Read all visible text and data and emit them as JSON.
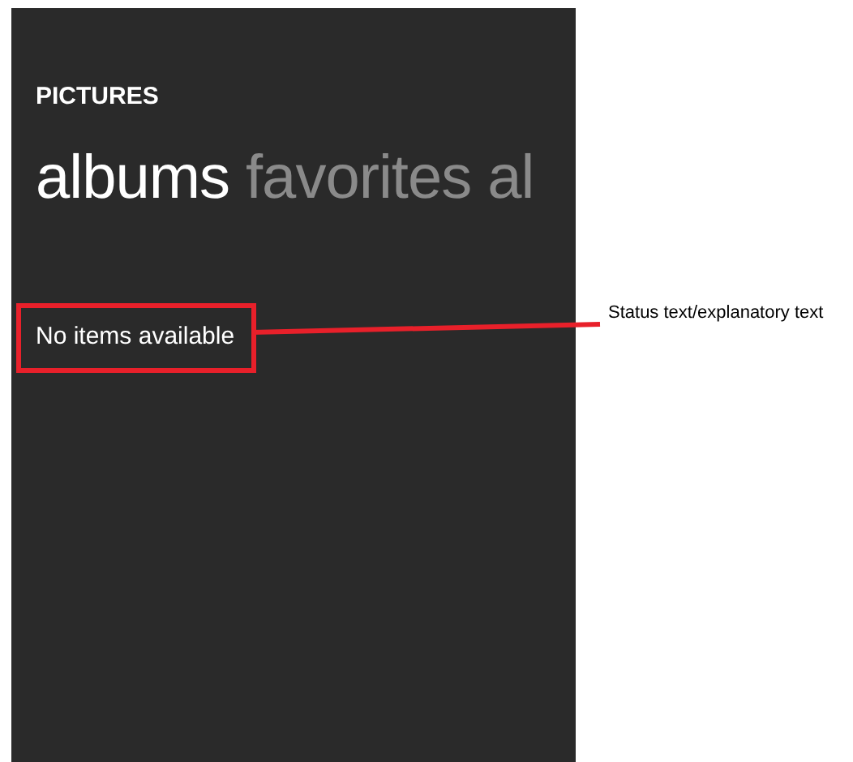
{
  "screen": {
    "app_title": "PICTURES",
    "pivot_items": [
      {
        "label": "albums",
        "selected": true
      },
      {
        "label": "favorites",
        "selected": false
      },
      {
        "label": "al",
        "selected": false
      }
    ],
    "status_text": "No items available"
  },
  "annotations": [
    {
      "text": "Status text/explanatory text"
    }
  ]
}
